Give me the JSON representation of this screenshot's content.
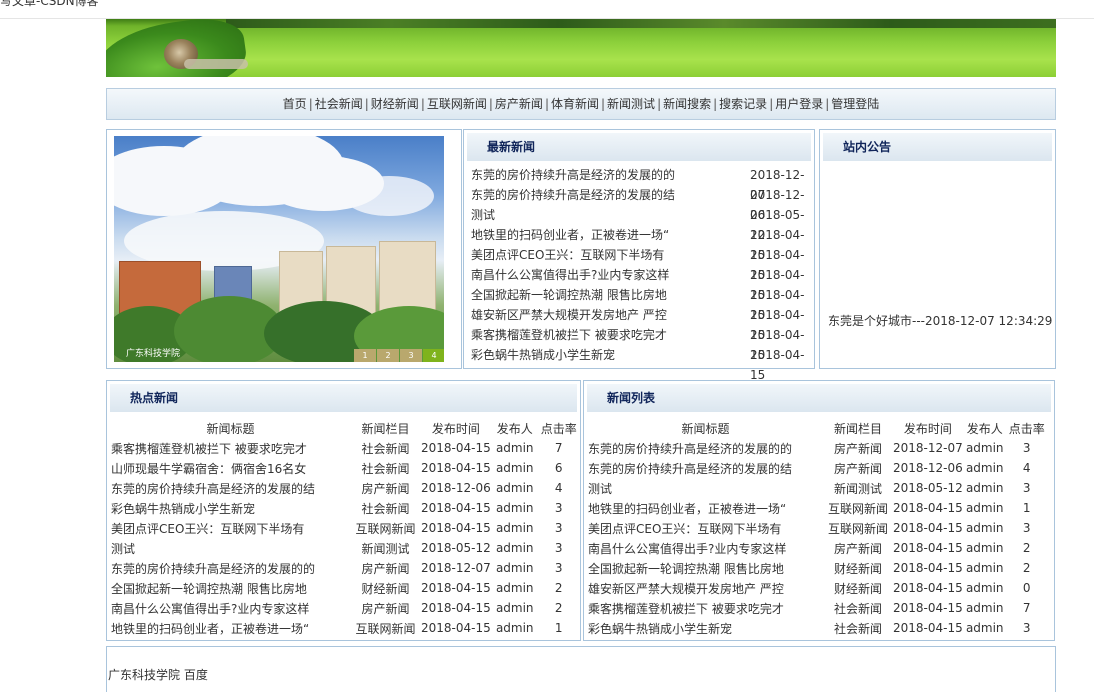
{
  "tab": {
    "title": "写文章-CSDN博客"
  },
  "nav": {
    "items": [
      "首页",
      "社会新闻",
      "财经新闻",
      "互联网新闻",
      "房产新闻",
      "体育新闻",
      "新闻测试",
      "新闻搜索",
      "搜索记录",
      "用户登录",
      "管理登陆"
    ],
    "separator": "|"
  },
  "slideshow": {
    "caption": "广东科技学院",
    "pages": [
      "1",
      "2",
      "3",
      "4"
    ],
    "active_page": "4"
  },
  "latest": {
    "title": "最新新闻",
    "items": [
      {
        "title": "东莞的房价持续升高是经济的发展的的",
        "date": "2018-12-07"
      },
      {
        "title": "东莞的房价持续升高是经济的发展的结",
        "date": "2018-12-06"
      },
      {
        "title": "测试",
        "date": "2018-05-12"
      },
      {
        "title": "地铁里的扫码创业者，正被卷进一场“",
        "date": "2018-04-15"
      },
      {
        "title": "美团点评CEO王兴：互联网下半场有",
        "date": "2018-04-15"
      },
      {
        "title": "南昌什么公寓值得出手?业内专家这样",
        "date": "2018-04-15"
      },
      {
        "title": "全国掀起新一轮调控热潮 限售比房地",
        "date": "2018-04-15"
      },
      {
        "title": "雄安新区严禁大规模开发房地产 严控",
        "date": "2018-04-15"
      },
      {
        "title": "乘客携榴莲登机被拦下 被要求吃完才",
        "date": "2018-04-15"
      },
      {
        "title": "彩色蜗牛热销成小学生新宠",
        "date": "2018-04-15"
      }
    ]
  },
  "notice": {
    "title": "站内公告",
    "text": "东莞是个好城市---2018-12-07 12:34:29"
  },
  "hot": {
    "title": "热点新闻",
    "columns": [
      "新闻标题",
      "新闻栏目",
      "发布时间",
      "发布人",
      "点击率"
    ],
    "rows": [
      [
        "乘客携榴莲登机被拦下 被要求吃完才",
        "社会新闻",
        "2018-04-15",
        "admin",
        "7"
      ],
      [
        "山师现最牛学霸宿舍：俩宿舍16名女",
        "社会新闻",
        "2018-04-15",
        "admin",
        "6"
      ],
      [
        "东莞的房价持续升高是经济的发展的结",
        "房产新闻",
        "2018-12-06",
        "admin",
        "4"
      ],
      [
        "彩色蜗牛热销成小学生新宠",
        "社会新闻",
        "2018-04-15",
        "admin",
        "3"
      ],
      [
        "美团点评CEO王兴：互联网下半场有",
        "互联网新闻",
        "2018-04-15",
        "admin",
        "3"
      ],
      [
        "测试",
        "新闻测试",
        "2018-05-12",
        "admin",
        "3"
      ],
      [
        "东莞的房价持续升高是经济的发展的的",
        "房产新闻",
        "2018-12-07",
        "admin",
        "3"
      ],
      [
        "全国掀起新一轮调控热潮 限售比房地",
        "财经新闻",
        "2018-04-15",
        "admin",
        "2"
      ],
      [
        "南昌什么公寓值得出手?业内专家这样",
        "房产新闻",
        "2018-04-15",
        "admin",
        "2"
      ],
      [
        "地铁里的扫码创业者，正被卷进一场“",
        "互联网新闻",
        "2018-04-15",
        "admin",
        "1"
      ]
    ]
  },
  "newslist": {
    "title": "新闻列表",
    "columns": [
      "新闻标题",
      "新闻栏目",
      "发布时间",
      "发布人",
      "点击率"
    ],
    "rows": [
      [
        "东莞的房价持续升高是经济的发展的的",
        "房产新闻",
        "2018-12-07",
        "admin",
        "3"
      ],
      [
        "东莞的房价持续升高是经济的发展的结",
        "房产新闻",
        "2018-12-06",
        "admin",
        "4"
      ],
      [
        "测试",
        "新闻测试",
        "2018-05-12",
        "admin",
        "3"
      ],
      [
        "地铁里的扫码创业者，正被卷进一场“",
        "互联网新闻",
        "2018-04-15",
        "admin",
        "1"
      ],
      [
        "美团点评CEO王兴：互联网下半场有",
        "互联网新闻",
        "2018-04-15",
        "admin",
        "3"
      ],
      [
        "南昌什么公寓值得出手?业内专家这样",
        "房产新闻",
        "2018-04-15",
        "admin",
        "2"
      ],
      [
        "全国掀起新一轮调控热潮 限售比房地",
        "财经新闻",
        "2018-04-15",
        "admin",
        "2"
      ],
      [
        "雄安新区严禁大规模开发房地产 严控",
        "财经新闻",
        "2018-04-15",
        "admin",
        "0"
      ],
      [
        "乘客携榴莲登机被拦下 被要求吃完才",
        "社会新闻",
        "2018-04-15",
        "admin",
        "7"
      ],
      [
        "彩色蜗牛热销成小学生新宠",
        "社会新闻",
        "2018-04-15",
        "admin",
        "3"
      ]
    ]
  },
  "footer": {
    "links": [
      "广东科技学院",
      "百度"
    ]
  }
}
